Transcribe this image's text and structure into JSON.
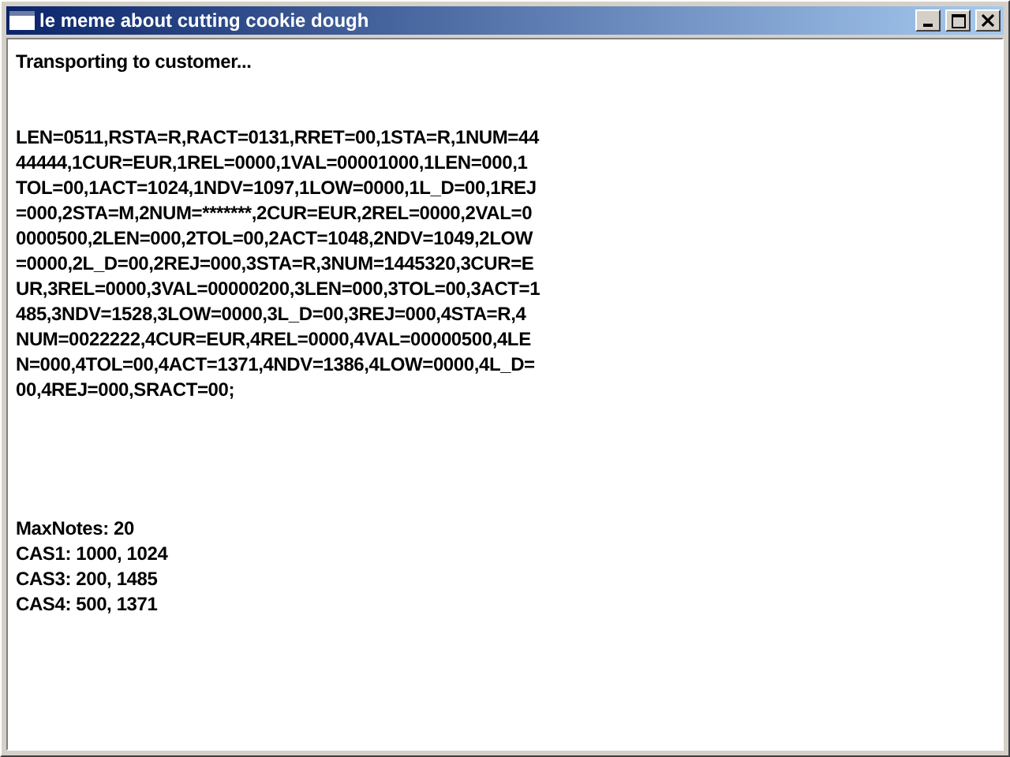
{
  "window": {
    "title": "le meme about cutting cookie dough",
    "controls": [
      {
        "kind": "minimize"
      },
      {
        "kind": "maximize"
      },
      {
        "kind": "close"
      }
    ]
  },
  "status": "Transporting to customer...",
  "message_lines": [
    "LEN=0511,RSTA=R,RACT=0131,RRET=00,1STA=R,1NUM=44",
    "44444,1CUR=EUR,1REL=0000,1VAL=00001000,1LEN=000,1",
    "TOL=00,1ACT=1024,1NDV=1097,1LOW=0000,1L_D=00,1REJ",
    "=000,2STA=M,2NUM=*******,2CUR=EUR,2REL=0000,2VAL=0",
    "0000500,2LEN=000,2TOL=00,2ACT=1048,2NDV=1049,2LOW",
    "=0000,2L_D=00,2REJ=000,3STA=R,3NUM=1445320,3CUR=E",
    "UR,3REL=0000,3VAL=00000200,3LEN=000,3TOL=00,3ACT=1",
    "485,3NDV=1528,3LOW=0000,3L_D=00,3REJ=000,4STA=R,4",
    "NUM=0022222,4CUR=EUR,4REL=0000,4VAL=00000500,4LE",
    "N=000,4TOL=00,4ACT=1371,4NDV=1386,4LOW=0000,4L_D=",
    "00,4REJ=000,SRACT=00;"
  ],
  "summary_lines": [
    "MaxNotes: 20",
    "CAS1: 1000, 1024",
    "CAS3: 200, 1485",
    "CAS4: 500, 1371"
  ]
}
